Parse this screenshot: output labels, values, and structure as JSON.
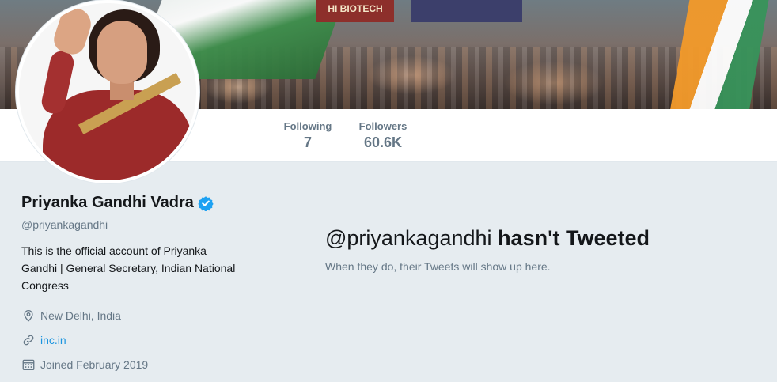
{
  "banner": {
    "sign_text": "HI BIOTECH"
  },
  "stats": {
    "following": {
      "label": "Following",
      "value": "7"
    },
    "followers": {
      "label": "Followers",
      "value": "60.6K"
    }
  },
  "profile": {
    "name": "Priyanka Gandhi Vadra",
    "handle": "@priyankagandhi",
    "bio": "This is the official account of Priyanka Gandhi | General Secretary, Indian National Congress",
    "location": "New Delhi, India",
    "website": "inc.in",
    "joined": "Joined February 2019",
    "verified": true
  },
  "empty_state": {
    "title_handle": "@priyankagandhi",
    "title_rest": "hasn't Tweeted",
    "subtitle": "When they do, their Tweets will show up here."
  },
  "colors": {
    "link": "#1b95e0",
    "verified": "#1da1f2",
    "muted": "#657786",
    "background": "#e6ecf0"
  },
  "icons": {
    "location": "location-pin-icon",
    "link": "link-icon",
    "calendar": "calendar-icon",
    "verified": "verified-badge-icon"
  }
}
